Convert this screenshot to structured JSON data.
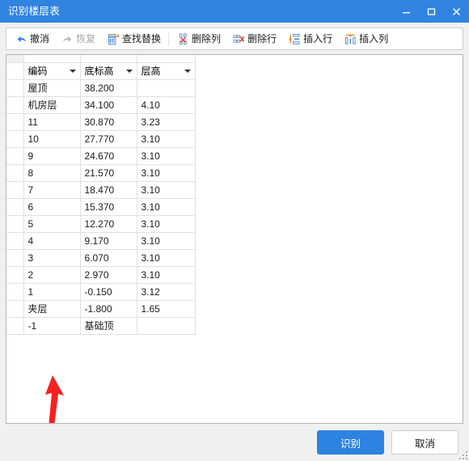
{
  "window": {
    "title": "识别楼层表",
    "accent_color": "#3083df",
    "controls": [
      {
        "name": "minimize",
        "glyph": "minimize-icon"
      },
      {
        "name": "maximize",
        "glyph": "maximize-icon"
      },
      {
        "name": "close",
        "glyph": "close-icon"
      }
    ]
  },
  "toolbar": {
    "items": [
      {
        "label": "撤消",
        "icon": "undo-icon",
        "disabled": false
      },
      {
        "label": "恢复",
        "icon": "redo-icon",
        "disabled": true
      },
      {
        "label": "查找替换",
        "icon": "find-replace-icon",
        "disabled": false
      },
      {
        "label": "删除列",
        "icon": "delete-column-icon",
        "disabled": false
      },
      {
        "label": "删除行",
        "icon": "delete-row-icon",
        "disabled": false
      },
      {
        "label": "插入行",
        "icon": "insert-row-icon",
        "disabled": false
      },
      {
        "label": "插入列",
        "icon": "insert-column-icon",
        "disabled": false
      }
    ]
  },
  "grid": {
    "columns": [
      {
        "label": "编码",
        "filter": true
      },
      {
        "label": "底标高",
        "filter": true
      },
      {
        "label": "层高",
        "filter": true
      }
    ],
    "highlight_color": "#f79d9b",
    "rows": [
      {
        "code": "屋顶",
        "base": "38.200",
        "height": ""
      },
      {
        "code": "机房层",
        "base": "34.100",
        "height": "4.10"
      },
      {
        "code": "11",
        "base": "30.870",
        "height": "3.23"
      },
      {
        "code": "10",
        "base": "27.770",
        "height": "3.10"
      },
      {
        "code": "9",
        "base": "24.670",
        "height": "3.10"
      },
      {
        "code": "8",
        "base": "21.570",
        "height": "3.10"
      },
      {
        "code": "7",
        "base": "18.470",
        "height": "3.10"
      },
      {
        "code": "6",
        "base": "15.370",
        "height": "3.10"
      },
      {
        "code": "5",
        "base": "12.270",
        "height": "3.10"
      },
      {
        "code": "4",
        "base": "9.170",
        "height": "3.10"
      },
      {
        "code": "3",
        "base": "6.070",
        "height": "3.10"
      },
      {
        "code": "2",
        "base": "2.970",
        "height": "3.10"
      },
      {
        "code": "1",
        "base": "-0.150",
        "height": "3.12"
      },
      {
        "code": "夹层",
        "base": "-1.800",
        "height": "1.65",
        "highlight": "code"
      },
      {
        "code": "-1",
        "base": "基础顶",
        "height": ""
      }
    ]
  },
  "annotation": {
    "type": "arrow",
    "color": "#fa2020",
    "points_to": "夹层"
  },
  "footer": {
    "primary_label": "识别",
    "secondary_label": "取消"
  }
}
